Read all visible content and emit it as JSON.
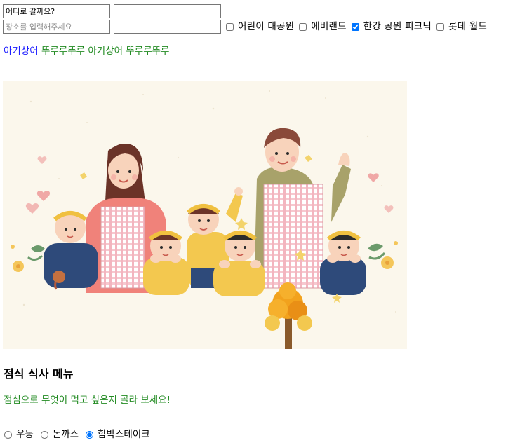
{
  "form": {
    "row1": {
      "first_input_value": "어디로 갈까요?",
      "second_input_value": ""
    },
    "row2": {
      "first_input_placeholder": "장소를 입력해주세요",
      "second_input_value": ""
    },
    "places": [
      {
        "label": "어린이 대공원",
        "checked": false
      },
      {
        "label": "에버랜드",
        "checked": false
      },
      {
        "label": "한강 공원 피크닉",
        "checked": true
      },
      {
        "label": "롯데 월드",
        "checked": false
      }
    ]
  },
  "song": {
    "part1": "아기상어",
    "part2": "뚜루루뚜루",
    "part3": "아기상어",
    "part4": "뚜루루뚜루"
  },
  "lunch": {
    "title": "점식 식사 메뉴",
    "subtitle": "점심으로 무엇이 먹고 싶은지 골라 보세요!",
    "options": [
      {
        "label": "우동",
        "checked": false
      },
      {
        "label": "돈까스",
        "checked": false
      },
      {
        "label": "함박스테이크",
        "checked": true
      }
    ]
  },
  "colors": {
    "link_blue": "#1f1fff",
    "green_text": "#228b22",
    "illustration_bg": "#fbf7ec",
    "checkbox_accent": "#0075ff"
  }
}
